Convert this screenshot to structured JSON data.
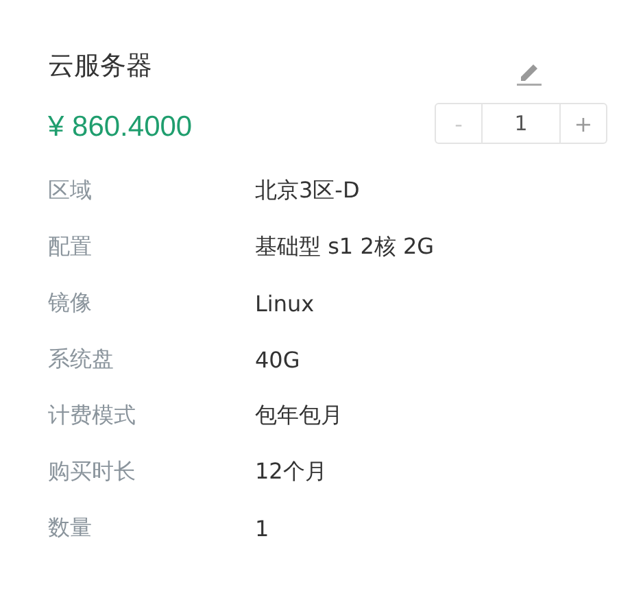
{
  "title": "云服务器",
  "price": "¥ 860.4000",
  "stepper": {
    "decrease": "-",
    "value": "1",
    "increase": "+",
    "decrease_disabled": true
  },
  "details": [
    {
      "label": "区域",
      "value": "北京3区-D"
    },
    {
      "label": "配置",
      "value": "基础型 s1 2核 2G"
    },
    {
      "label": "镜像",
      "value": "Linux"
    },
    {
      "label": "系统盘",
      "value": "40G"
    },
    {
      "label": "计费模式",
      "value": "包年包月"
    },
    {
      "label": "购买时长",
      "value": "12个月"
    },
    {
      "label": "数量",
      "value": "1"
    }
  ]
}
